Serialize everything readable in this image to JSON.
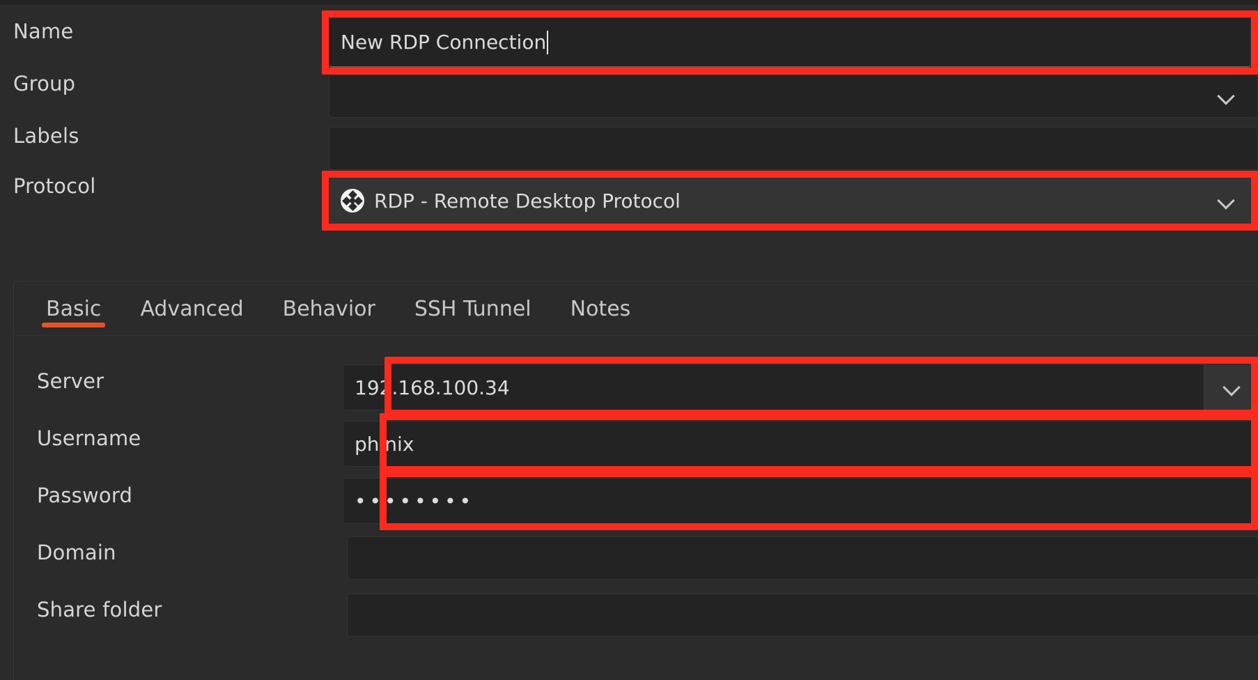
{
  "theme": {
    "background": "#2b2b2b",
    "input_background": "#232323",
    "accent": "#e8522a",
    "highlight": "#fa2b1e",
    "text": "#d6d6d6"
  },
  "form": {
    "fields": [
      {
        "label": "Name",
        "value": "New RDP Connection",
        "placeholder": ""
      },
      {
        "label": "Group",
        "value": "",
        "placeholder": ""
      },
      {
        "label": "Labels",
        "value": "",
        "placeholder": ""
      },
      {
        "label": "Protocol",
        "value": "RDP - Remote Desktop Protocol",
        "placeholder": "",
        "icon": "rdp-protocol-icon"
      }
    ]
  },
  "tabs": {
    "items": [
      {
        "label": "Basic",
        "active": true
      },
      {
        "label": "Advanced",
        "active": false
      },
      {
        "label": "Behavior",
        "active": false
      },
      {
        "label": "SSH Tunnel",
        "active": false
      },
      {
        "label": "Notes",
        "active": false
      }
    ]
  },
  "basic": {
    "fields": [
      {
        "label": "Server",
        "value": "192.168.100.34",
        "placeholder": ""
      },
      {
        "label": "Username",
        "value": "phinix",
        "placeholder": ""
      },
      {
        "label": "Password",
        "value": "••••••••",
        "placeholder": ""
      },
      {
        "label": "Domain",
        "value": "",
        "placeholder": ""
      },
      {
        "label": "Share folder",
        "value": "",
        "placeholder": ""
      }
    ]
  },
  "icons": {
    "chevron_down": "chevron-down-icon",
    "protocol": "rdp-protocol-icon"
  }
}
